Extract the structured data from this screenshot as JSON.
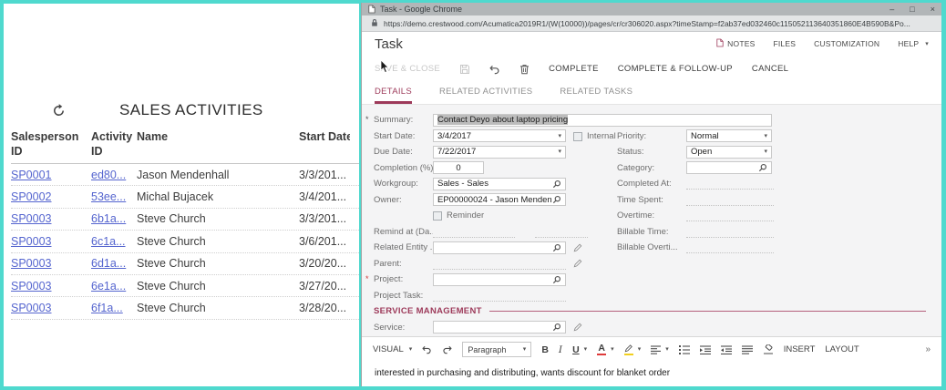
{
  "icons": {
    "caret_down": "▾",
    "more_chevron": "»",
    "window_minimize": "–",
    "window_maximize": "□",
    "window_close": "×"
  },
  "sales_panel": {
    "title": "SALES ACTIVITIES",
    "columns": [
      "Salesperson ID",
      "Activity ID",
      "Name",
      "Start Date"
    ],
    "rows": [
      [
        "SP0001",
        "ed80...",
        "Jason Mendenhall",
        "3/3/201..."
      ],
      [
        "SP0002",
        "53ee...",
        "Michal Bujacek",
        "3/4/201..."
      ],
      [
        "SP0003",
        "6b1a...",
        "Steve Church",
        "3/3/201..."
      ],
      [
        "SP0003",
        "6c1a...",
        "Steve Church",
        "3/6/201..."
      ],
      [
        "SP0003",
        "6d1a...",
        "Steve Church",
        "3/20/20..."
      ],
      [
        "SP0003",
        "6e1a...",
        "Steve Church",
        "3/27/20..."
      ],
      [
        "SP0003",
        "6f1a...",
        "Steve Church",
        "3/28/20..."
      ]
    ]
  },
  "browser": {
    "window_title": "Task - Google Chrome",
    "url": "https://demo.crestwood.com/Acumatica2019R1/(W(10000))/pages/cr/cr306020.aspx?timeStamp=f2ab37ed032460c115052113640351860E4B590B&Po..."
  },
  "page": {
    "title": "Task",
    "menu": {
      "notes": "NOTES",
      "files": "FILES",
      "customization": "CUSTOMIZATION",
      "help": "HELP"
    },
    "toolbar": {
      "save_close": "SAVE & CLOSE",
      "complete": "COMPLETE",
      "complete_follow_up": "COMPLETE & FOLLOW-UP",
      "cancel": "CANCEL"
    },
    "tabs": {
      "details": "DETAILS",
      "related_activities": "RELATED ACTIVITIES",
      "related_tasks": "RELATED TASKS"
    }
  },
  "form": {
    "required_marker": "*",
    "summary": {
      "label": "Summary:",
      "value": "Contact Deyo about laptop pricing"
    },
    "start_date": {
      "label": "Start Date:",
      "value": "3/4/2017"
    },
    "internal": {
      "label": "Internal"
    },
    "priority": {
      "label": "Priority:",
      "value": "Normal"
    },
    "due_date": {
      "label": "Due Date:",
      "value": "7/22/2017"
    },
    "status": {
      "label": "Status:",
      "value": "Open"
    },
    "completion": {
      "label": "Completion (%):",
      "value": "0"
    },
    "category": {
      "label": "Category:",
      "value": ""
    },
    "workgroup": {
      "label": "Workgroup:",
      "value": "Sales - Sales"
    },
    "completed_at": {
      "label": "Completed At:",
      "value": ""
    },
    "owner": {
      "label": "Owner:",
      "value": "EP00000024 - Jason Menden"
    },
    "time_spent": {
      "label": "Time Spent:",
      "value": ""
    },
    "reminder": {
      "label": "Reminder"
    },
    "overtime": {
      "label": "Overtime:",
      "value": ""
    },
    "remind_at": {
      "label": "Remind at (Da...",
      "value": ""
    },
    "billable_time": {
      "label": "Billable Time:",
      "value": ""
    },
    "related_entity": {
      "label": "Related Entity ...",
      "value": ""
    },
    "billable_overtime": {
      "label": "Billable Overti...",
      "value": ""
    },
    "parent": {
      "label": "Parent:",
      "value": ""
    },
    "project": {
      "label": "Project:",
      "value": ""
    },
    "project_task": {
      "label": "Project Task:",
      "value": ""
    },
    "section_service": "SERVICE MANAGEMENT",
    "service": {
      "label": "Service:",
      "value": ""
    }
  },
  "editor": {
    "visual": "VISUAL",
    "paragraph": "Paragraph",
    "bold": "B",
    "italic": "I",
    "underline": "U",
    "text_color": "A",
    "insert": "INSERT",
    "layout": "LAYOUT",
    "body_text": "interested in purchasing and distributing, wants discount for blanket order"
  }
}
